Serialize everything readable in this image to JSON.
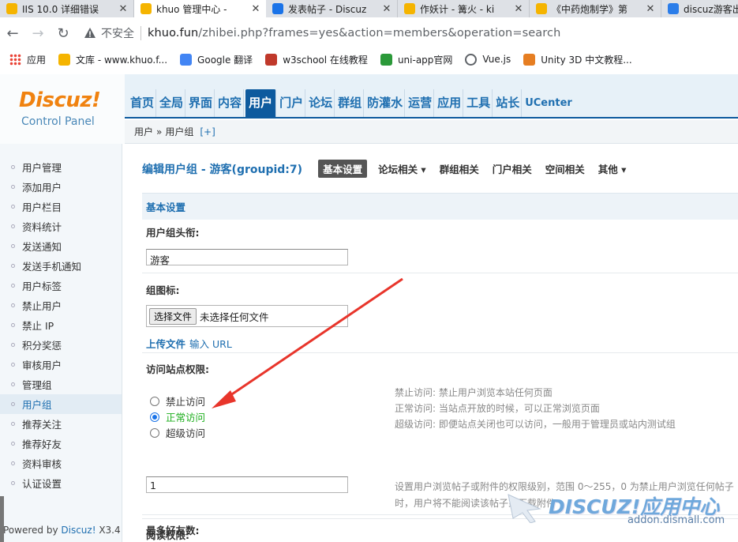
{
  "browser": {
    "tabs": [
      {
        "title": "IIS 10.0 详细错误",
        "icon_color": "#f5b400",
        "active": false
      },
      {
        "title": "khuo 管理中心 -",
        "icon_color": "#f5b400",
        "active": true
      },
      {
        "title": "发表帖子 - Discuz",
        "icon_color": "#1a73e8",
        "active": false
      },
      {
        "title": "作妖计 - 篝火 - ki",
        "icon_color": "#f5b400",
        "active": false
      },
      {
        "title": "《中药炮制学》第",
        "icon_color": "#f5b400",
        "active": false
      },
      {
        "title": "discuz游客出现",
        "icon_color": "#2b7de9",
        "active": false
      }
    ],
    "security_label": "不安全",
    "url_host": "khuo.fun",
    "url_path": "/zhibei.php?frames=yes&action=members&operation=search",
    "bookmarks": [
      {
        "label": "应用",
        "icon": "apps-grid-icon"
      },
      {
        "label": "文库 - www.khuo.f...",
        "icon": "cloud-icon"
      },
      {
        "label": "Google 翻译",
        "icon": "translate-icon"
      },
      {
        "label": "w3school 在线教程",
        "icon": "w3-icon"
      },
      {
        "label": "uni-app官网",
        "icon": "uniapp-icon"
      },
      {
        "label": "Vue.js",
        "icon": "globe-icon"
      },
      {
        "label": "Unity 3D 中文教程...",
        "icon": "lion-icon"
      }
    ]
  },
  "logo": {
    "title": "Discuz!",
    "subtitle": "Control Panel"
  },
  "topnav": [
    {
      "label": "首页"
    },
    {
      "label": "全局"
    },
    {
      "label": "界面"
    },
    {
      "label": "内容"
    },
    {
      "label": "用户",
      "active": true
    },
    {
      "label": "门户"
    },
    {
      "label": "论坛"
    },
    {
      "label": "群组"
    },
    {
      "label": "防灌水"
    },
    {
      "label": "运营"
    },
    {
      "label": "应用"
    },
    {
      "label": "工具"
    },
    {
      "label": "站长"
    },
    {
      "label": "UCenter"
    }
  ],
  "breadcrumb": {
    "root": "用户",
    "sep": "»",
    "current": "用户组",
    "add": "[+]"
  },
  "sidebar": {
    "items": [
      {
        "label": "用户管理"
      },
      {
        "label": "添加用户"
      },
      {
        "label": "用户栏目"
      },
      {
        "label": "资料统计"
      },
      {
        "label": "发送通知"
      },
      {
        "label": "发送手机通知"
      },
      {
        "label": "用户标签"
      },
      {
        "label": "禁止用户"
      },
      {
        "label": "禁止 IP"
      },
      {
        "label": "积分奖惩"
      },
      {
        "label": "审核用户"
      },
      {
        "label": "管理组"
      },
      {
        "label": "用户组",
        "active": true
      },
      {
        "label": "推荐关注"
      },
      {
        "label": "推荐好友"
      },
      {
        "label": "资料审核"
      },
      {
        "label": "认证设置"
      }
    ],
    "footer_prefix": "Powered by ",
    "footer_brand": "Discuz!",
    "footer_version": " X3.4"
  },
  "editor": {
    "title": "编辑用户组 - 游客(groupid:7)",
    "tabs": [
      {
        "label": "基本设置",
        "active": true
      },
      {
        "label": "论坛相关 ▾"
      },
      {
        "label": "群组相关"
      },
      {
        "label": "门户相关"
      },
      {
        "label": "空间相关"
      },
      {
        "label": "其他 ▾"
      }
    ],
    "section_title": "基本设置",
    "group_title_label": "用户组头衔:",
    "group_title_value": "游客",
    "group_icon_label": "组图标:",
    "file_button": "选择文件",
    "file_status": "未选择任何文件",
    "upload_file": "上传文件",
    "input_url": "输入 URL",
    "access_label": "访问站点权限:",
    "access_options": [
      {
        "label": "禁止访问",
        "checked": false,
        "tip": "禁止访问: 禁止用户浏览本站任何页面"
      },
      {
        "label": "正常访问",
        "checked": true,
        "tip": "正常访问: 当站点开放的时候，可以正常浏览页面"
      },
      {
        "label": "超级访问",
        "checked": false,
        "tip": "超级访问: 即便站点关闭也可以访问，一般用于管理员或站内测试组"
      }
    ],
    "read_label": "阅读权限:",
    "read_value": "1",
    "read_tip_line1": "设置用户浏览帖子或附件的权限级别，范围 0～255，0 为禁止用户浏览任何帖子",
    "read_tip_line2": "时，用户将不能阅读该帖子或下载附件",
    "max_friends_label": "最多好友数:"
  },
  "watermark": {
    "main": "DISCUZ!应用中心",
    "sub": "addon.dismall.com"
  },
  "colors": {
    "accent": "#1f6fb0",
    "nav_active": "#0d5a9e",
    "arrow": "#e8352b",
    "checked_text": "#1cae1c"
  }
}
